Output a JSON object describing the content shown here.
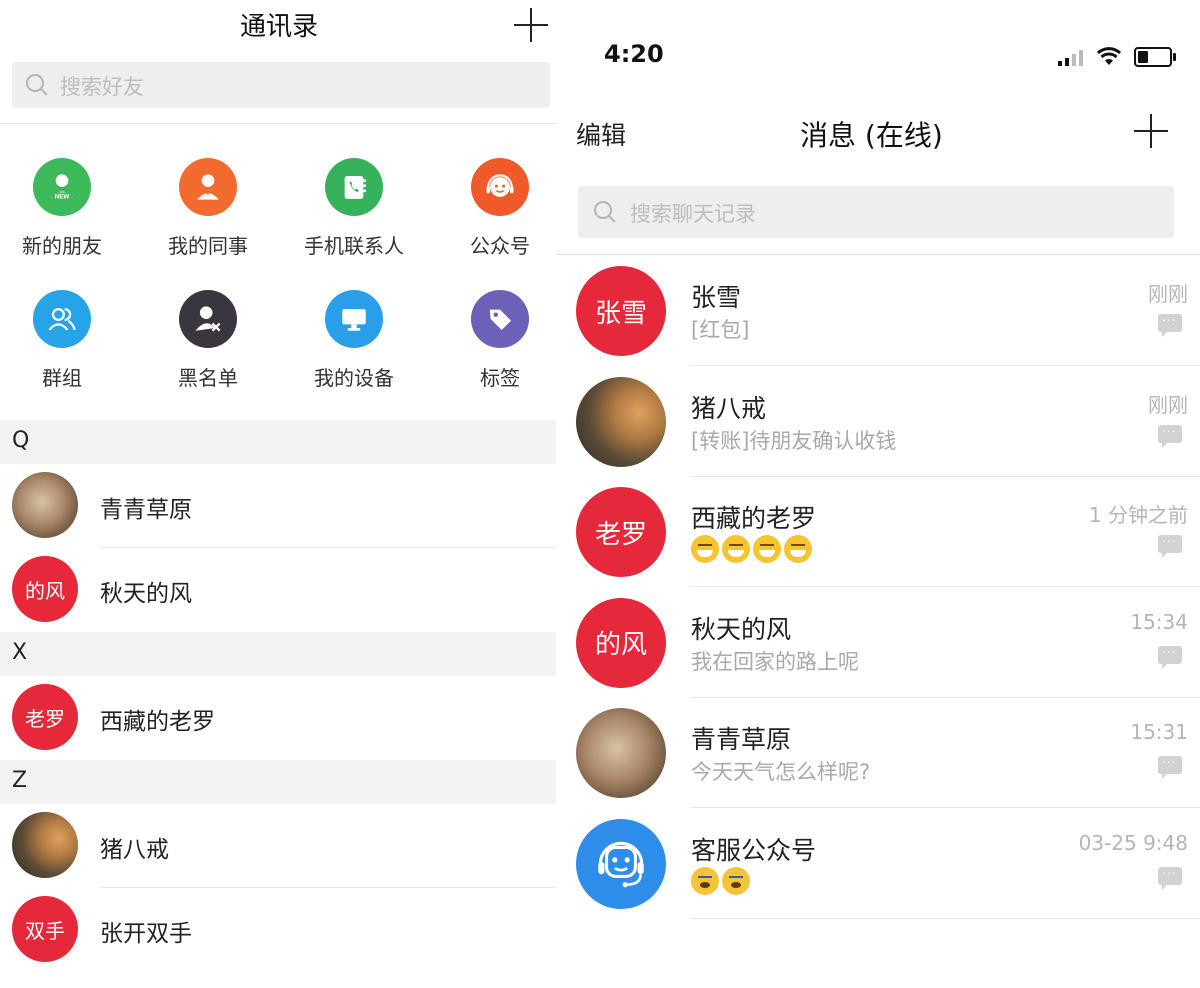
{
  "contacts_screen": {
    "title": "通讯录",
    "search_placeholder": "搜索好友",
    "functions": [
      {
        "label": "新的朋友",
        "icon": "new-friend-icon",
        "color": "#3cb95a",
        "badge": "NEW"
      },
      {
        "label": "我的同事",
        "icon": "colleague-icon",
        "color": "#f26a2e"
      },
      {
        "label": "手机联系人",
        "icon": "phone-contacts-icon",
        "color": "#35b25a"
      },
      {
        "label": "公众号",
        "icon": "official-account-icon",
        "color": "#f05a2a"
      },
      {
        "label": "群组",
        "icon": "group-icon",
        "color": "#27a4e9"
      },
      {
        "label": "黑名单",
        "icon": "blacklist-icon",
        "color": "#3b3540"
      },
      {
        "label": "我的设备",
        "icon": "device-icon",
        "color": "#2a9ee8"
      },
      {
        "label": "标签",
        "icon": "tag-icon",
        "color": "#6b62b8"
      }
    ],
    "sections": [
      {
        "letter": "Q",
        "contacts": [
          {
            "name": "青青草原",
            "avatar_type": "photo-cat",
            "avatar_text": ""
          },
          {
            "name": "秋天的风",
            "avatar_type": "text",
            "avatar_text": "的风"
          }
        ]
      },
      {
        "letter": "X",
        "contacts": [
          {
            "name": "西藏的老罗",
            "avatar_type": "text",
            "avatar_text": "老罗"
          }
        ]
      },
      {
        "letter": "Z",
        "contacts": [
          {
            "name": "猪八戒",
            "avatar_type": "photo-dog",
            "avatar_text": ""
          },
          {
            "name": "张开双手",
            "avatar_type": "text",
            "avatar_text": "双手"
          }
        ]
      }
    ]
  },
  "messages_screen": {
    "status": {
      "time": "4:20"
    },
    "edit_label": "编辑",
    "title": "消息 (在线)",
    "search_placeholder": "搜索聊天记录",
    "conversations": [
      {
        "name": "张雪",
        "preview": "[红包]",
        "time": "刚刚",
        "avatar_type": "text",
        "avatar_text": "张雪"
      },
      {
        "name": "猪八戒",
        "preview": "[转账]待朋友确认收钱",
        "time": "刚刚",
        "avatar_type": "photo-dog",
        "avatar_text": ""
      },
      {
        "name": "西藏的老罗",
        "preview": "",
        "emoji": [
          "grin",
          "grin",
          "grin",
          "grin"
        ],
        "time": "1 分钟之前",
        "avatar_type": "text",
        "avatar_text": "老罗"
      },
      {
        "name": "秋天的风",
        "preview": "我在回家的路上呢",
        "time": "15:34",
        "avatar_type": "text",
        "avatar_text": "的风"
      },
      {
        "name": "青青草原",
        "preview": "今天天气怎么样呢?",
        "time": "15:31",
        "avatar_type": "photo-cat",
        "avatar_text": ""
      },
      {
        "name": "客服公众号",
        "preview": "",
        "emoji": [
          "fear",
          "fear"
        ],
        "time": "03-25 9:48",
        "avatar_type": "agent",
        "avatar_text": ""
      }
    ]
  }
}
